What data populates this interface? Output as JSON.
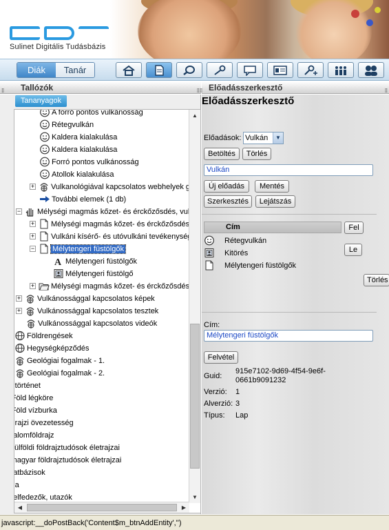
{
  "logo": {
    "letters": "SDT",
    "subtitle": "Sulinet Digitális Tudásbázis"
  },
  "nav": {
    "roles": [
      "Diák",
      "Tanár"
    ],
    "active_role": "Diák",
    "buttons": [
      "home-icon",
      "document-icon",
      "search-icon",
      "key-icon",
      "message-icon",
      "id-card-icon",
      "key-plus-icon",
      "users-icon",
      "group-icon"
    ]
  },
  "left": {
    "title": "Tallózók",
    "tab": "Tananyagok",
    "tree": [
      {
        "indent": 36,
        "expander": "",
        "icon": "smiley-icon",
        "label": "A forró pontos vulkánosság"
      },
      {
        "indent": 36,
        "expander": "",
        "icon": "smiley-icon",
        "label": "Rétegvulkán"
      },
      {
        "indent": 36,
        "expander": "",
        "icon": "smiley-icon",
        "label": "Kaldera kialakulása"
      },
      {
        "indent": 36,
        "expander": "",
        "icon": "smiley-icon",
        "label": "Kaldera kialakulása"
      },
      {
        "indent": 36,
        "expander": "",
        "icon": "smiley-icon",
        "label": "Forró pontos vulkánosság"
      },
      {
        "indent": 36,
        "expander": "",
        "icon": "smiley-icon",
        "label": "Atollok kialakulása"
      },
      {
        "indent": 22,
        "expander": "+",
        "icon": "weblink-icon",
        "label": "Vulkanológiával kapcsolatos webhelyek gy"
      },
      {
        "indent": 36,
        "expander": "",
        "icon": "arrow-icon",
        "label": "További elemek (1 db)"
      },
      {
        "indent": 2,
        "expander": "−",
        "icon": "hand-icon",
        "label": "Mélységi magmás kőzet- és érckőzősdés, vulk"
      },
      {
        "indent": 22,
        "expander": "+",
        "icon": "page-icon",
        "label": "Mélységi magmás kőzet- és érckőzősdés"
      },
      {
        "indent": 22,
        "expander": "+",
        "icon": "page-icon",
        "label": "Vulkáni kísérő- és utóvulkáni tevékenysége"
      },
      {
        "indent": 22,
        "expander": "−",
        "icon": "page-icon",
        "label": "Mélytengeri füstölgők",
        "selected": true
      },
      {
        "indent": 56,
        "expander": "",
        "icon": "text-a-icon",
        "label": "Mélytengeri füstölgők"
      },
      {
        "indent": 56,
        "expander": "",
        "icon": "image-icon",
        "label": "Mélytengeri füstölgő"
      },
      {
        "indent": 22,
        "expander": "+",
        "icon": "folder-icon",
        "label": "Mélységi magmás kőzet- és érckőzősdés,"
      },
      {
        "indent": 2,
        "expander": "+",
        "icon": "weblink-icon",
        "label": "Vulkánossággal kapcsolatos képek"
      },
      {
        "indent": 2,
        "expander": "+",
        "icon": "weblink-icon",
        "label": "Vulkánossággal kapcsolatos tesztek"
      },
      {
        "indent": 16,
        "expander": "",
        "icon": "weblink-icon",
        "label": "Vulkánossággal kapcsolatos videók"
      },
      {
        "indent": 0,
        "expander": "",
        "icon": "globe-icon",
        "label": "Földrengések"
      },
      {
        "indent": 0,
        "expander": "",
        "icon": "globe-icon",
        "label": "Hegységképződés"
      },
      {
        "indent": 0,
        "expander": "",
        "icon": "weblink-icon",
        "label": "Geológiai fogalmak - 1."
      },
      {
        "indent": 0,
        "expander": "",
        "icon": "weblink-icon",
        "label": "Geológiai fogalmak - 2."
      },
      {
        "indent": -14,
        "expander": "",
        "icon": "",
        "label": "öldtörténet"
      },
      {
        "indent": -14,
        "expander": "",
        "icon": "",
        "label": "A Föld légköre"
      },
      {
        "indent": -14,
        "expander": "",
        "icon": "",
        "label": "A Föld vízburka"
      },
      {
        "indent": -14,
        "expander": "",
        "icon": "",
        "label": "öldrajzi övezetesség"
      },
      {
        "indent": -14,
        "expander": "",
        "icon": "",
        "label": "adalomföldrajz"
      },
      {
        "indent": -14,
        "expander": "",
        "icon": "",
        "label": "s külföldi földrajztudósok életrajzai"
      },
      {
        "indent": -14,
        "expander": "",
        "icon": "",
        "label": "s magyar földrajztudósok életrajzai"
      },
      {
        "indent": -14,
        "expander": "",
        "icon": "",
        "label": "adatbázisok"
      },
      {
        "indent": -14,
        "expander": "",
        "icon": "",
        "label": "ógia"
      },
      {
        "indent": -14,
        "expander": "",
        "icon": "",
        "label": "., felfedezők, utazók"
      }
    ]
  },
  "right": {
    "head": "Előadásszerkesztő",
    "title": "Előadásszerkesztő",
    "eloadasok_label": "Előadások:",
    "selected_presentation": "Vulkán",
    "btn_betoltes": "Betöltés",
    "btn_torles": "Törlés",
    "name_value": "Vulkán",
    "btn_uj": "Új előadás",
    "btn_mentes": "Mentés",
    "btn_szerkesztes": "Szerkesztés",
    "btn_lejatszas": "Lejátszás",
    "col_cim": "Cím",
    "btn_fel": "Fel",
    "btn_le": "Le",
    "btn_torles2": "Törlés",
    "items": [
      {
        "icon": "smiley-icon",
        "label": "Rétegvulkán"
      },
      {
        "icon": "image-icon",
        "label": "Kitörés"
      },
      {
        "icon": "page-icon",
        "label": "Mélytengeri füstölgők"
      }
    ],
    "cim_label": "Cím:",
    "cim_value": "Mélytengeri füstölgők",
    "btn_felvetel": "Felvétel",
    "guid_label": "Guid:",
    "guid_line1": "915e7102-9d69-4f54-9e6f-",
    "guid_line2": "0661b9091232",
    "verzio_label": "Verzió:",
    "verzio_value": "1",
    "alverzio_label": "Alverzió:",
    "alverzio_value": "3",
    "tipus_label": "Típus:",
    "tipus_value": "Lap"
  },
  "status": {
    "text": "javascript:__doPostBack('Content$m_btnAddEntity','')"
  }
}
